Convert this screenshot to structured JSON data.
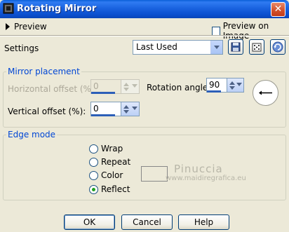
{
  "window": {
    "title": "Rotating Mirror",
    "close_glyph": "✕"
  },
  "preview": {
    "label": "Preview",
    "preview_on_image_label": "Preview on Image",
    "preview_on_image_checked": false
  },
  "settings": {
    "label": "Settings",
    "preset_value": "Last Used",
    "icons": [
      "save-icon",
      "randomize-dice-icon",
      "reset-arrow-icon"
    ]
  },
  "mirror_placement": {
    "title": "Mirror placement",
    "horizontal_offset_label": "Horizontal offset (%):",
    "horizontal_offset_value": "0",
    "rotation_angle_label": "Rotation angle:",
    "rotation_angle_value": "90",
    "vertical_offset_label": "Vertical offset (%):",
    "vertical_offset_value": "0"
  },
  "edge_mode": {
    "title": "Edge mode",
    "options": [
      "Wrap",
      "Repeat",
      "Color",
      "Reflect"
    ],
    "selected": "Reflect"
  },
  "watermark": {
    "name": "Pinuccia",
    "url": "www.maidiregrafica.eu"
  },
  "buttons": {
    "ok": "OK",
    "cancel": "Cancel",
    "help": "Help"
  },
  "colors": {
    "title_bar": "#0a5fd8",
    "group_title": "#0046d5",
    "radio_dot": "#21a121",
    "background": "#ece9d8"
  }
}
